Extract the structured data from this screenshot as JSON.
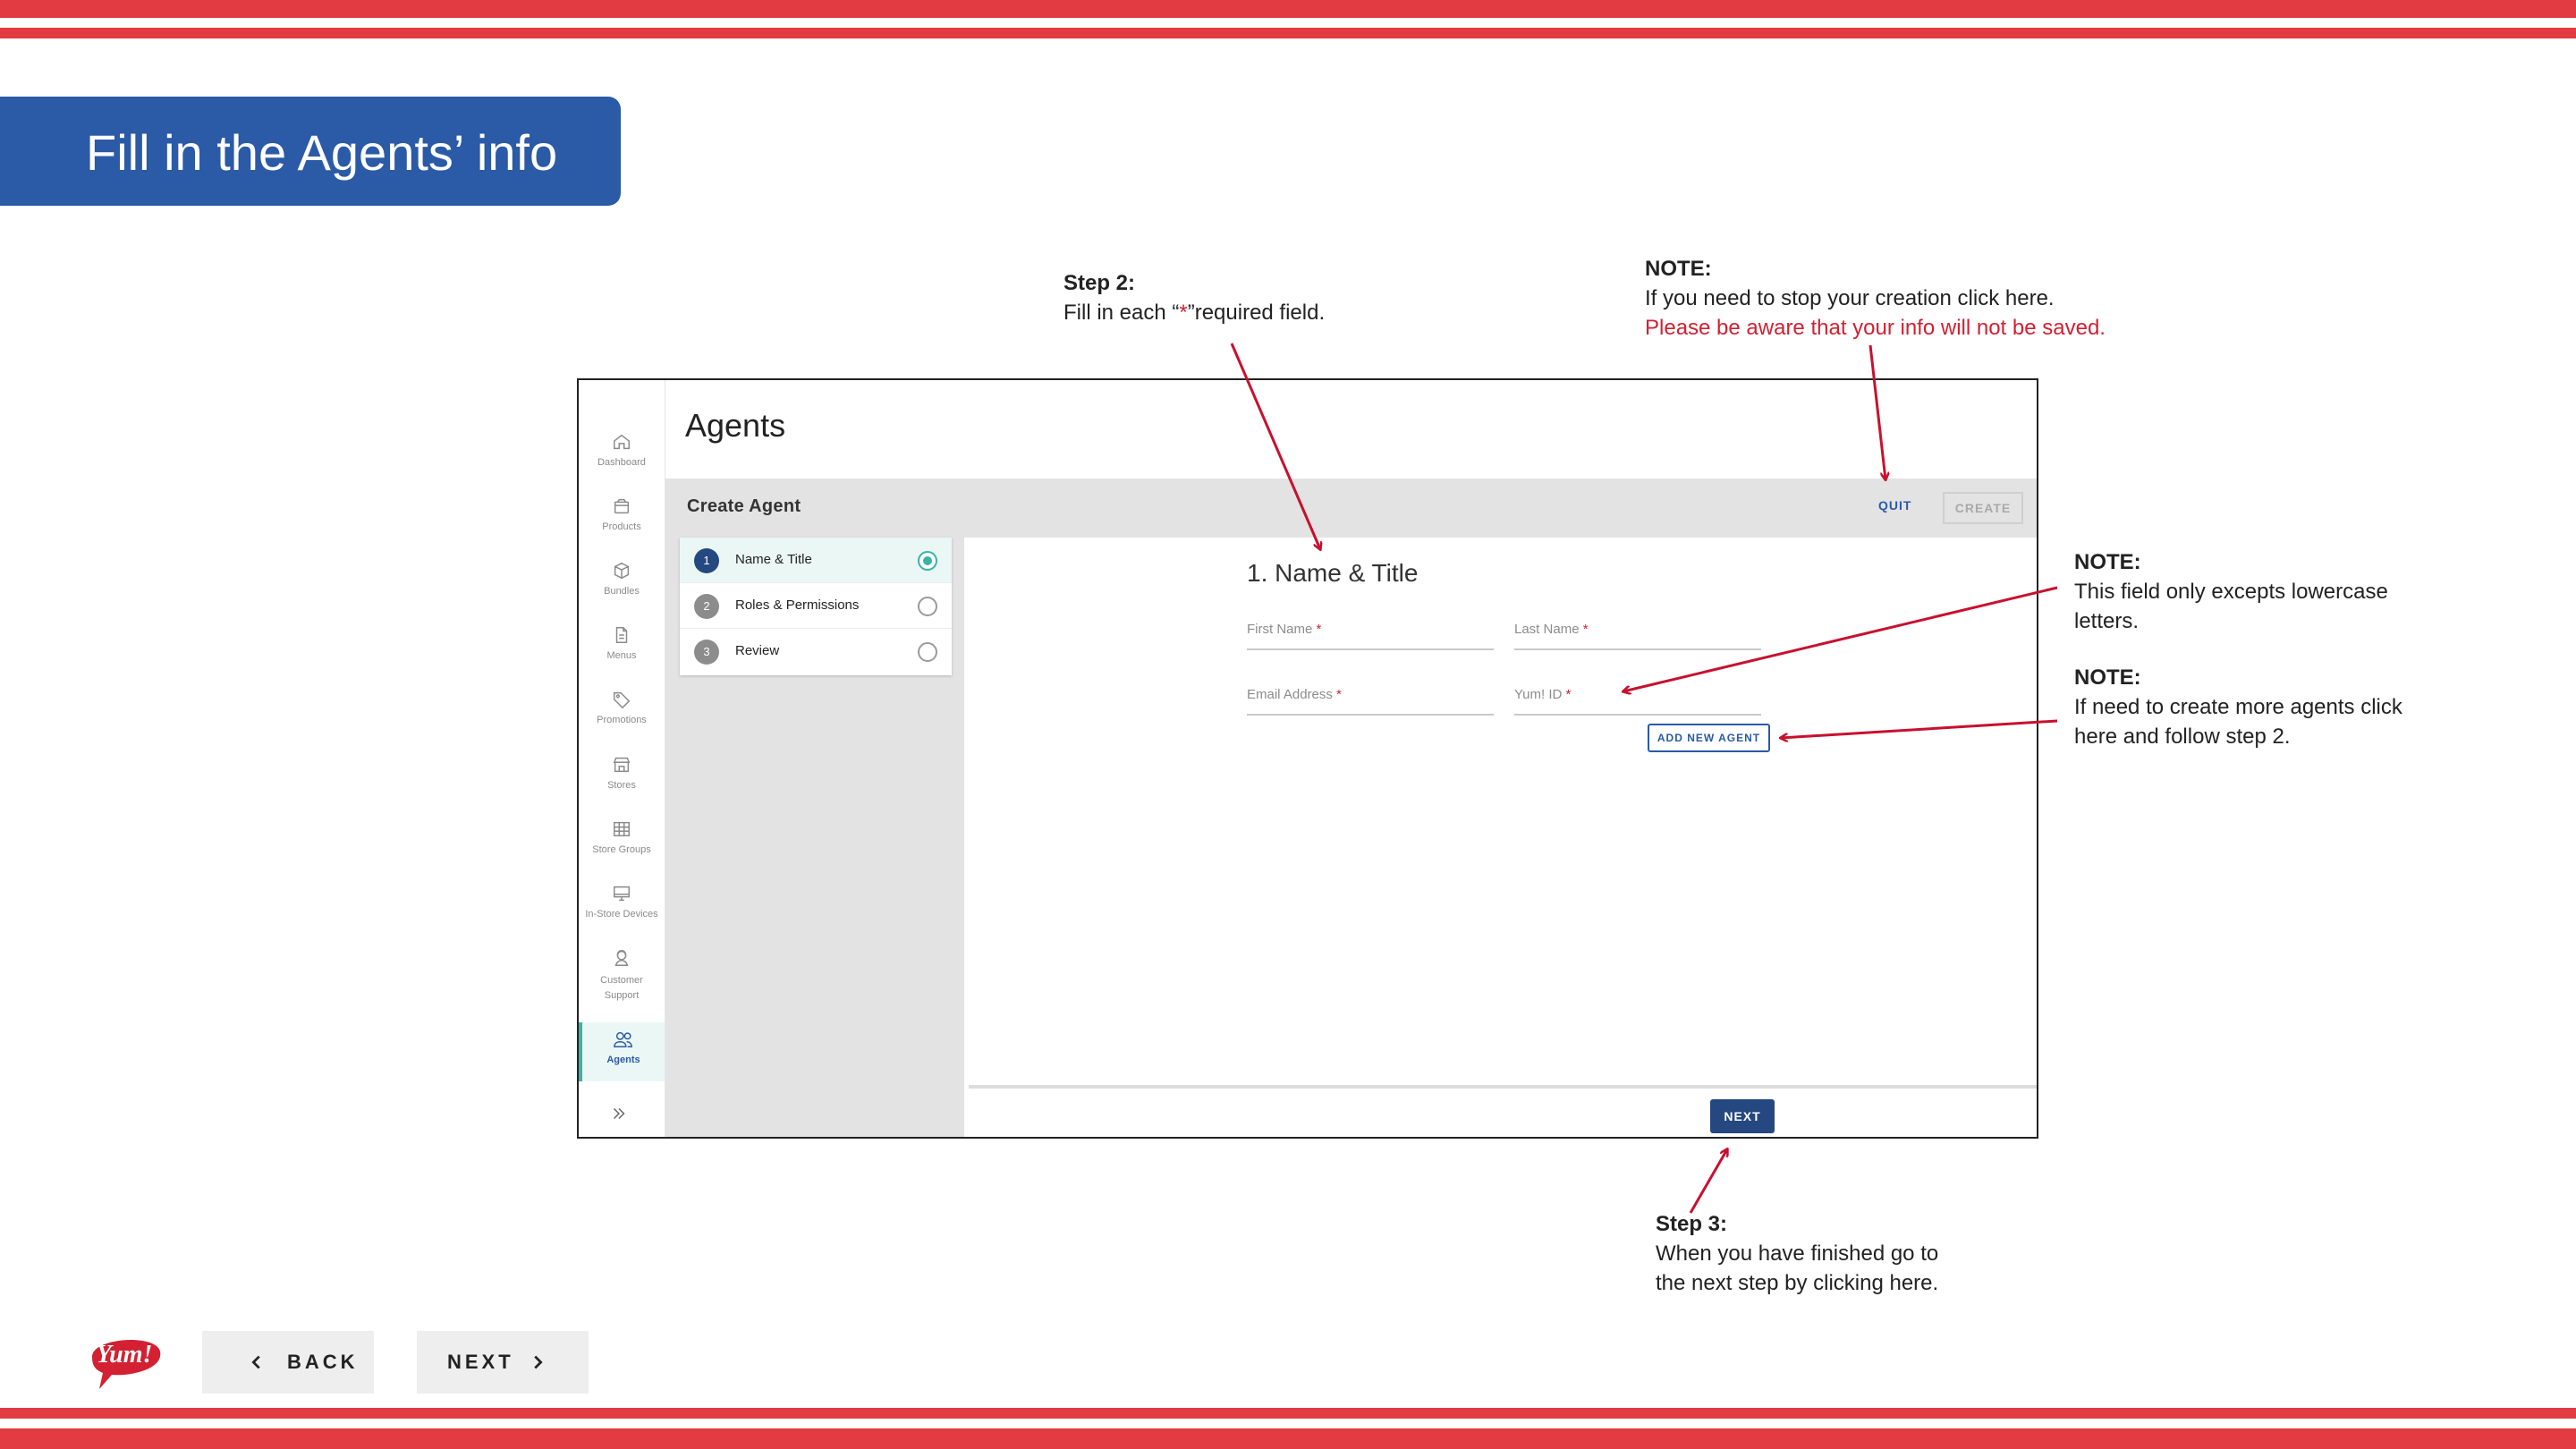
{
  "banner": {
    "title": "Fill in the Agents’ info"
  },
  "callouts": {
    "step2": {
      "heading": "Step 2:",
      "line_prefix": "Fill in each “",
      "line_star": "*",
      "line_suffix": "”required field."
    },
    "note_quit": {
      "heading": "NOTE:",
      "line1": "If you need to stop your creation click here.",
      "line2": "Please be aware that your info will not be saved."
    },
    "note_lowercase": {
      "heading": "NOTE:",
      "line1": "This field only excepts lowercase",
      "line2": "letters."
    },
    "note_add": {
      "heading": "NOTE:",
      "line1": "If need to create more agents click",
      "line2": "here and follow step 2."
    },
    "step3": {
      "heading": "Step 3:",
      "line1": "When you have finished go to",
      "line2": "the next step by clicking here."
    }
  },
  "app": {
    "title": "Agents",
    "sidebar": {
      "items": [
        {
          "label": "Dashboard",
          "icon": "home-icon"
        },
        {
          "label": "Products",
          "icon": "box-icon"
        },
        {
          "label": "Bundles",
          "icon": "cube-icon"
        },
        {
          "label": "Menus",
          "icon": "document-icon"
        },
        {
          "label": "Promotions",
          "icon": "tag-icon"
        },
        {
          "label": "Stores",
          "icon": "store-icon"
        },
        {
          "label": "Store Groups",
          "icon": "grid-icon"
        },
        {
          "label": "In-Store Devices",
          "icon": "monitor-icon"
        },
        {
          "label": "Customer",
          "label2": "Support",
          "icon": "support-icon"
        },
        {
          "label": "Agents",
          "icon": "users-icon"
        }
      ],
      "active": "Agents",
      "expand_icon": "chevrons-right-icon"
    },
    "toolbar": {
      "title": "Create Agent",
      "quit_label": "QUIT",
      "create_label": "CREATE"
    },
    "steps": [
      {
        "num": "1",
        "label": "Name & Title"
      },
      {
        "num": "2",
        "label": "Roles & Permissions"
      },
      {
        "num": "3",
        "label": "Review"
      }
    ],
    "form": {
      "heading": "1. Name & Title",
      "first_name": "First Name",
      "last_name": "Last Name",
      "email": "Email Address",
      "yum_id": "Yum! ID",
      "required_mark": "*",
      "add_agent_label": "ADD NEW AGENT",
      "next_label": "NEXT"
    }
  },
  "bottom_nav": {
    "logo_text": "Yum!",
    "back_label": "BACK",
    "next_label": "NEXT"
  },
  "colors": {
    "accent_red": "#e23b42",
    "brand_blue": "#2b5aa6",
    "dark_blue": "#24487f",
    "teal": "#3ab3a6",
    "arrow_red": "#c8102e"
  }
}
